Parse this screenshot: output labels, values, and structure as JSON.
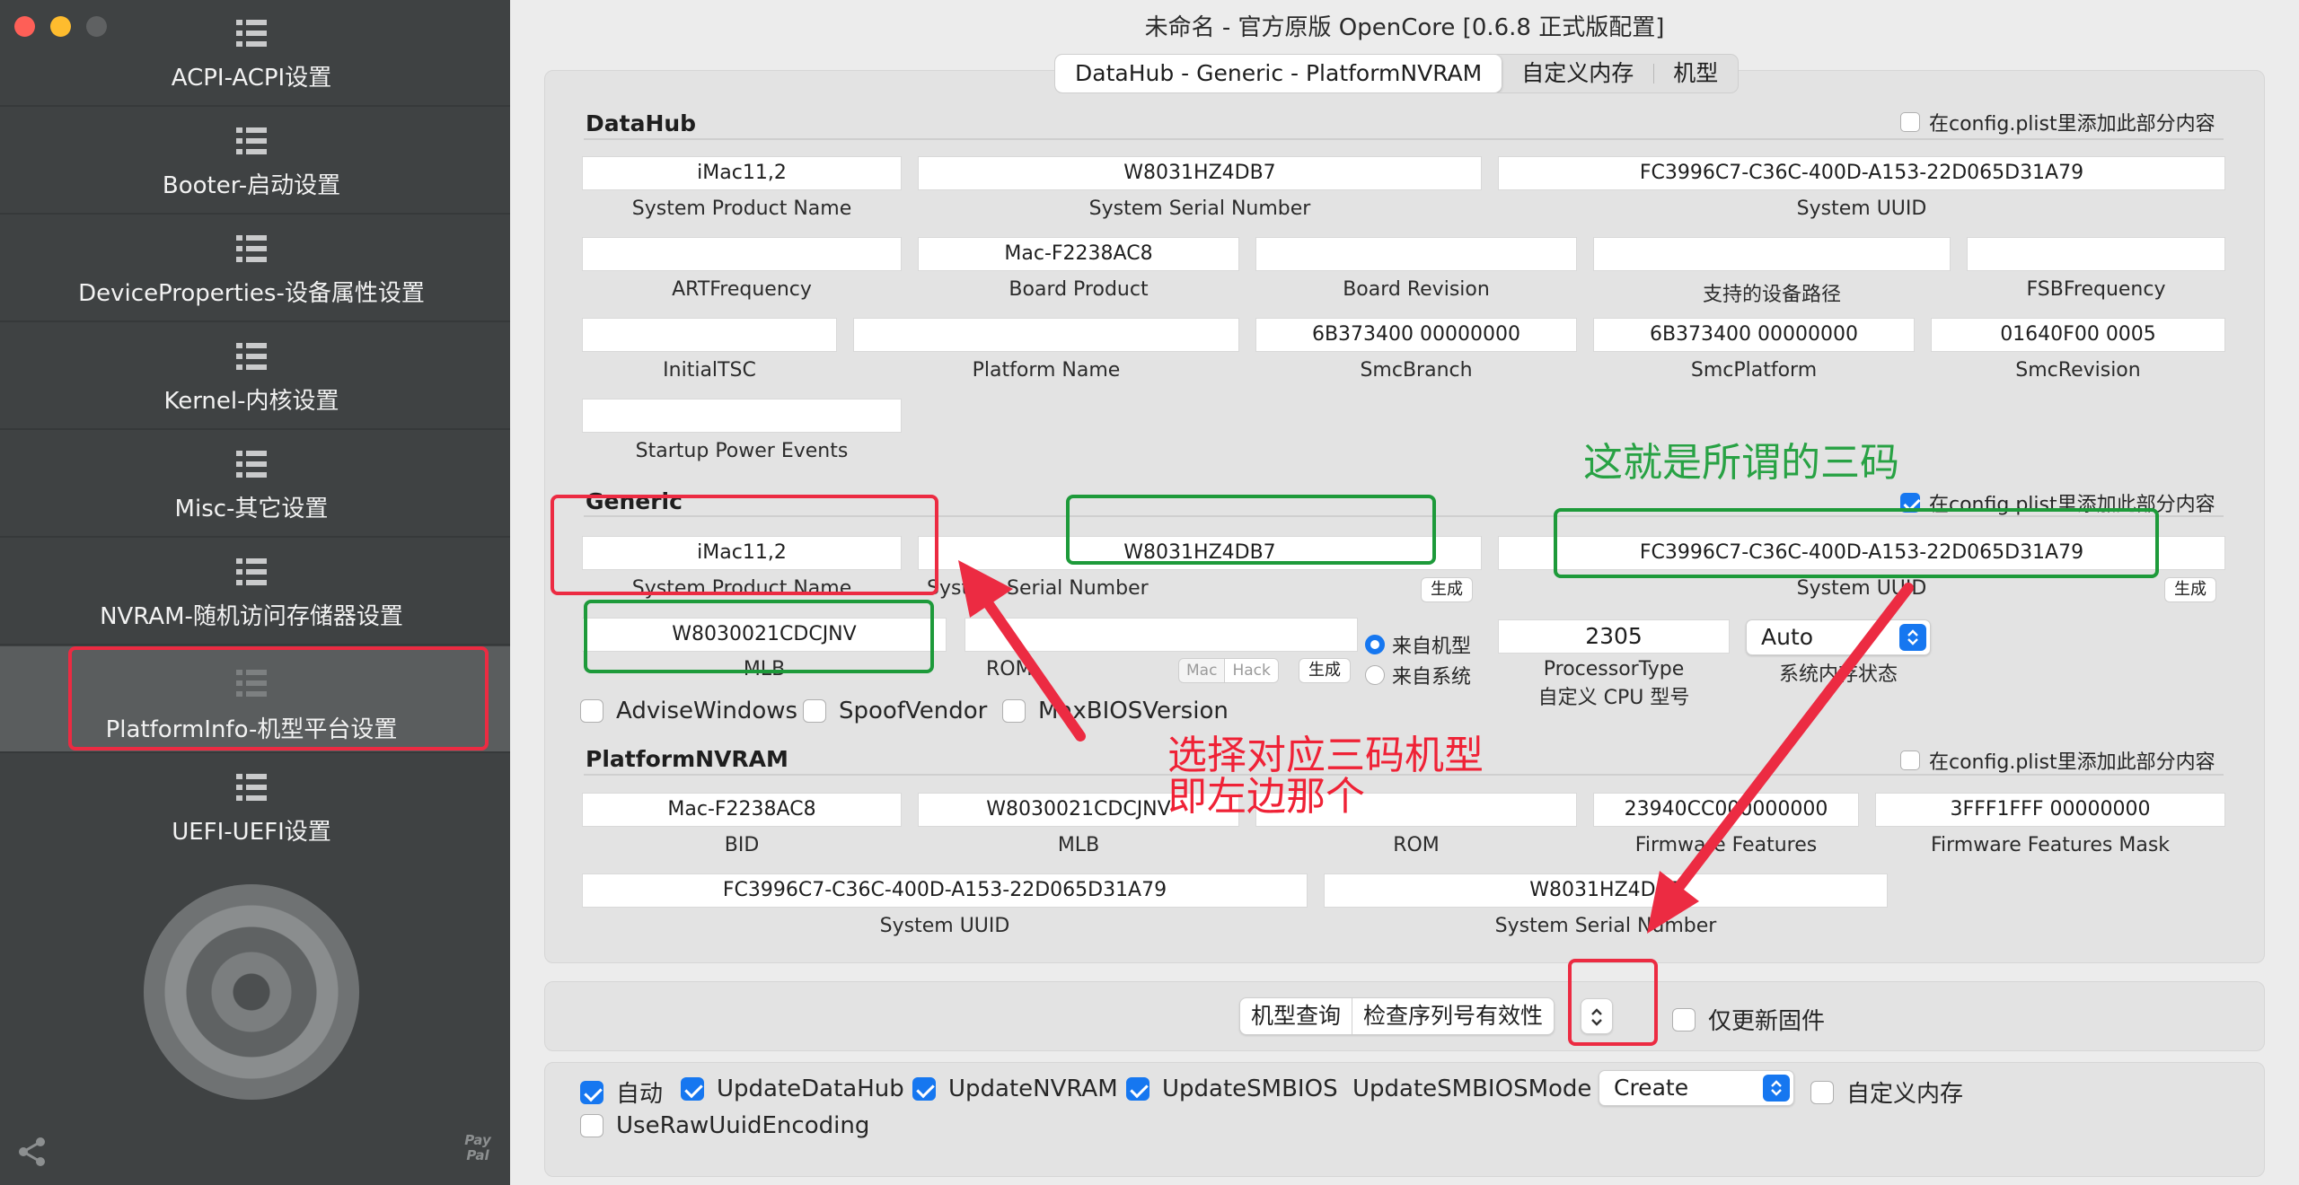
{
  "window": {
    "title": "未命名 - 官方原版 OpenCore [0.6.8 正式版配置]"
  },
  "sidebar": {
    "items": [
      {
        "label": "ACPI-ACPI设置"
      },
      {
        "label": "Booter-启动设置"
      },
      {
        "label": "DeviceProperties-设备属性设置"
      },
      {
        "label": "Kernel-内核设置"
      },
      {
        "label": "Misc-其它设置"
      },
      {
        "label": "NVRAM-随机访问存储器设置"
      },
      {
        "label": "PlatformInfo-机型平台设置",
        "active": true
      },
      {
        "label": "UEFI-UEFI设置"
      }
    ],
    "paypal": "Pay\nPal"
  },
  "tabs": [
    "DataHub - Generic - PlatformNVRAM",
    "自定义内存",
    "机型"
  ],
  "datahub": {
    "title": "DataHub",
    "add_checkbox": {
      "label": "在config.plist里添加此部分内容",
      "checked": false
    },
    "fields": [
      {
        "value": "iMac11,2",
        "label": "System Product Name"
      },
      {
        "value": "W8031HZ4DB7",
        "label": "System Serial Number"
      },
      {
        "value": "FC3996C7-C36C-400D-A153-22D065D31A79",
        "label": "System UUID"
      },
      {
        "value": "",
        "label": "ARTFrequency"
      },
      {
        "value": "Mac-F2238AC8",
        "label": "Board Product"
      },
      {
        "value": "",
        "label": "Board Revision"
      },
      {
        "value": "",
        "label": "支持的设备路径"
      },
      {
        "value": "",
        "label": "FSBFrequency"
      },
      {
        "value": "",
        "label": "InitialTSC"
      },
      {
        "value": "",
        "label": "Platform Name"
      },
      {
        "value": "6B373400 00000000",
        "label": "SmcBranch"
      },
      {
        "value": "6B373400 00000000",
        "label": "SmcPlatform"
      },
      {
        "value": "01640F00 0005",
        "label": "SmcRevision"
      },
      {
        "value": "",
        "label": "Startup Power Events"
      }
    ]
  },
  "generic": {
    "title": "Generic",
    "add_checkbox": {
      "label": "在config.plist里添加此部分内容",
      "checked": true
    },
    "product_name": {
      "value": "iMac11,2",
      "label": "System Product Name"
    },
    "serial": {
      "value": "W8031HZ4DB7",
      "label": "System Serial Number"
    },
    "uuid": {
      "value": "FC3996C7-C36C-400D-A153-22D065D31A79",
      "label": "System UUID"
    },
    "generate_label": "生成",
    "mlb": {
      "value": "W8030021CDCJNV",
      "label": "MLB"
    },
    "rom": {
      "value": "",
      "label": "ROM"
    },
    "rom_seg": [
      "Mac",
      "Hack"
    ],
    "radio_model": "来自机型",
    "radio_system": "来自系统",
    "processor_type": {
      "value": "2305",
      "label1": "ProcessorType",
      "label2": "自定义 CPU 型号"
    },
    "memory_status": {
      "value": "Auto",
      "label": "系统内存状态"
    },
    "advise_windows": "AdviseWindows",
    "spoof_vendor": "SpoofVendor",
    "max_bios": "MaxBIOSVersion"
  },
  "platform_nvram": {
    "title": "PlatformNVRAM",
    "add_checkbox": {
      "label": "在config.plist里添加此部分内容",
      "checked": false
    },
    "fields": [
      {
        "value": "Mac-F2238AC8",
        "label": "BID"
      },
      {
        "value": "W8030021CDCJNV",
        "label": "MLB"
      },
      {
        "value": "",
        "label": "ROM"
      },
      {
        "value": "23940CC000000000",
        "label": "Firmware Features"
      },
      {
        "value": "3FFF1FFF 00000000",
        "label": "Firmware Features Mask"
      },
      {
        "value": "FC3996C7-C36C-400D-A153-22D065D31A79",
        "label": "System UUID"
      },
      {
        "value": "W8031HZ4DB7",
        "label": "System Serial Number"
      }
    ]
  },
  "toolbar": {
    "model_query": "机型查询",
    "check_serial": "检查序列号有效性",
    "update_firmware_only": "仅更新固件"
  },
  "options": {
    "auto": "自动",
    "update_datahub": "UpdateDataHub",
    "update_nvram": "UpdateNVRAM",
    "update_smbios": "UpdateSMBIOS",
    "update_smbios_mode_label": "UpdateSMBIOSMode",
    "update_smbios_mode_value": "Create",
    "custom_memory": "自定义内存",
    "use_raw_uuid": "UseRawUuidEncoding"
  },
  "annotations": {
    "three_codes": "这就是所谓的三码",
    "choose_line1": "选择对应三码机型",
    "choose_line2": "即左边那个"
  },
  "colors": {
    "accent": "#1677f0",
    "annotation_red": "#ec2b42",
    "annotation_green": "#1d9a3a",
    "sidebar_bg": "#3f4243"
  }
}
